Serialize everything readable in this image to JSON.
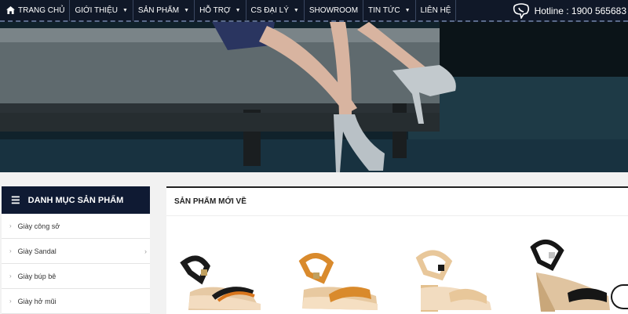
{
  "nav": {
    "home": "TRANG CHỦ",
    "items": [
      {
        "label": "GIỚI THIỆU",
        "caret": true
      },
      {
        "label": "SẢN PHẨM",
        "caret": true
      },
      {
        "label": "HỖ TRỢ",
        "caret": true
      },
      {
        "label": "CS ĐẠI LÝ",
        "caret": true
      },
      {
        "label": "SHOWROOM",
        "caret": false
      },
      {
        "label": "TIN TỨC",
        "caret": true
      },
      {
        "label": "LIÊN HỆ",
        "caret": false
      }
    ],
    "hotline": "Hotline : 1900 565683"
  },
  "sidebar": {
    "title": "DANH MỤC SẢN PHẨM",
    "items": [
      {
        "label": "Giày công sở"
      },
      {
        "label": "Giày Sandal"
      },
      {
        "label": "Giày búp bê"
      },
      {
        "label": "Giày hở mũi"
      }
    ]
  },
  "products": {
    "title": "SẢN PHẨM MỚI VỀ",
    "items": [
      {
        "name": "black-wedge-sandal",
        "color": "#1a1a1a",
        "accent": "#d9761c"
      },
      {
        "name": "tan-wedge-sandal",
        "color": "#d98a2c",
        "accent": "#d98a2c"
      },
      {
        "name": "beige-block-heel-sandal",
        "color": "#e8c79a",
        "accent": "#e8c79a"
      },
      {
        "name": "black-platform-sandal",
        "color": "#161616",
        "accent": "#161616"
      }
    ]
  }
}
